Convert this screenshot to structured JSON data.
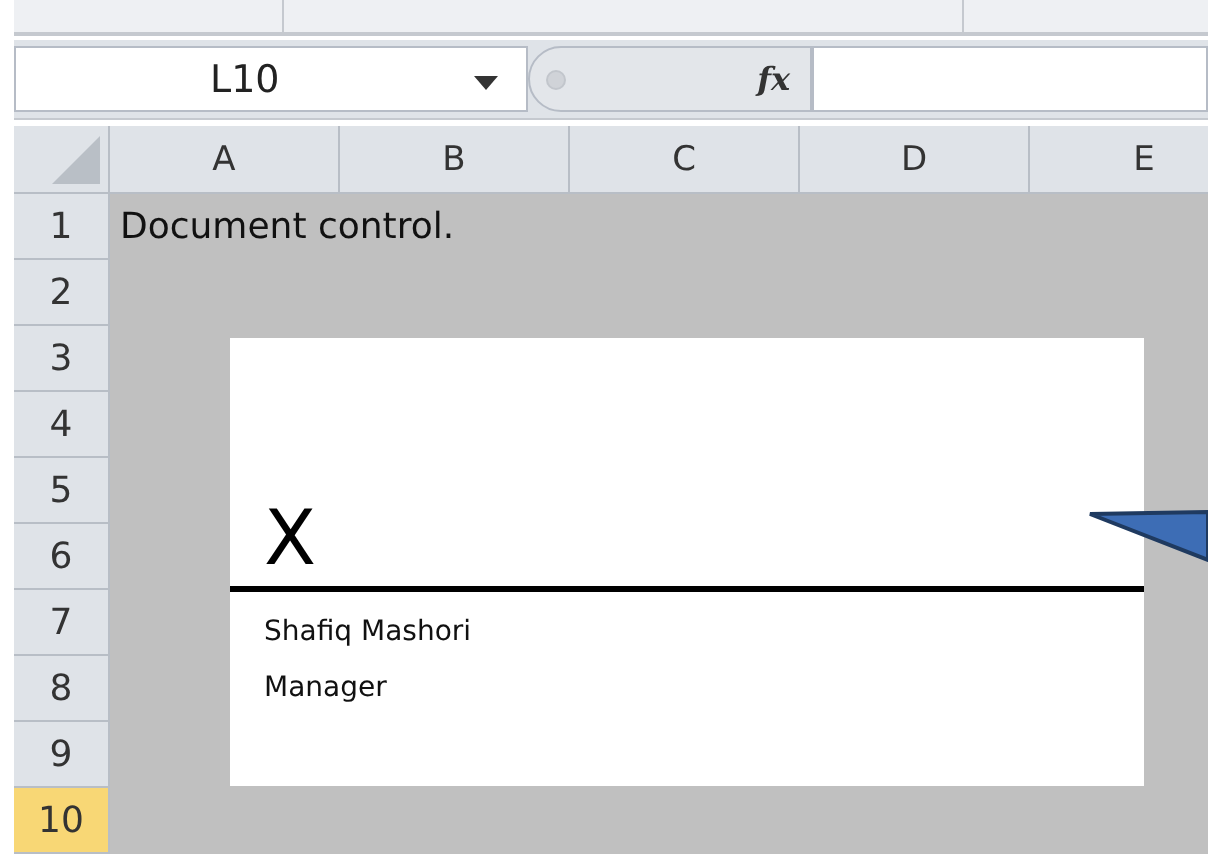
{
  "formula_bar": {
    "name_box": "L10",
    "function_label": "fx"
  },
  "columns": [
    {
      "label": "A",
      "selected": false
    },
    {
      "label": "B",
      "selected": false
    },
    {
      "label": "C",
      "selected": false
    },
    {
      "label": "D",
      "selected": false
    },
    {
      "label": "E",
      "selected": false
    }
  ],
  "rows": [
    {
      "label": "1",
      "selected": false
    },
    {
      "label": "2",
      "selected": false
    },
    {
      "label": "3",
      "selected": false
    },
    {
      "label": "4",
      "selected": false
    },
    {
      "label": "5",
      "selected": false
    },
    {
      "label": "6",
      "selected": false
    },
    {
      "label": "7",
      "selected": false
    },
    {
      "label": "8",
      "selected": false
    },
    {
      "label": "9",
      "selected": false
    },
    {
      "label": "10",
      "selected": true
    }
  ],
  "cells": [
    {
      "text": "Document control."
    }
  ],
  "signature_line": {
    "mark": "X",
    "signer_name": "Shafiq Mashori",
    "signer_title": "Manager"
  }
}
